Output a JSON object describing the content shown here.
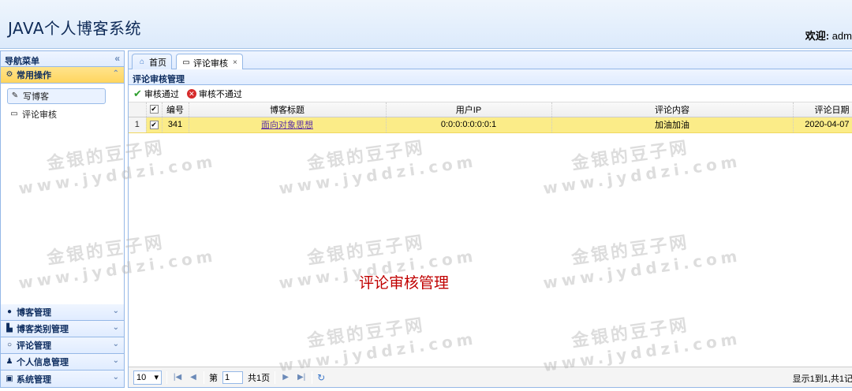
{
  "header": {
    "title": "JAVA个人博客系统",
    "welcome_label": "欢迎:",
    "welcome_user": "adm"
  },
  "nav": {
    "title": "导航菜单",
    "common": {
      "title": "常用操作",
      "items": [
        {
          "label": "写博客",
          "icon": "pencil-icon"
        },
        {
          "label": "评论审核",
          "icon": "comment-icon"
        }
      ]
    },
    "sections": [
      {
        "label": "博客管理",
        "icon": "blog-icon"
      },
      {
        "label": "博客类别管理",
        "icon": "category-icon"
      },
      {
        "label": "评论管理",
        "icon": "comment-icon"
      },
      {
        "label": "个人信息管理",
        "icon": "user-icon"
      },
      {
        "label": "系统管理",
        "icon": "system-icon"
      }
    ]
  },
  "tabs": [
    {
      "label": "首页",
      "icon": "home-icon"
    },
    {
      "label": "评论审核",
      "icon": "comment-icon",
      "closable": true
    }
  ],
  "panel": {
    "title": "评论审核管理",
    "toolbar": {
      "approve": "审核通过",
      "reject": "审核不通过"
    },
    "columns": [
      "编号",
      "博客标题",
      "用户IP",
      "评论内容",
      "评论日期"
    ],
    "rows": [
      {
        "rownum": "1",
        "id": "341",
        "blog_title": "面向对象思想",
        "ip": "0:0:0:0:0:0:0:1",
        "content": "加油加油",
        "date": "2020-04-07",
        "checked": true
      }
    ]
  },
  "overlay_text": "评论审核管理",
  "watermark": {
    "line1": "金银的豆子网",
    "line2": "www.jyddzi.com"
  },
  "pager": {
    "page_size": "10",
    "page_label_prefix": "第",
    "page_value": "1",
    "page_total": "共1页",
    "info": "显示1到1,共1记"
  }
}
